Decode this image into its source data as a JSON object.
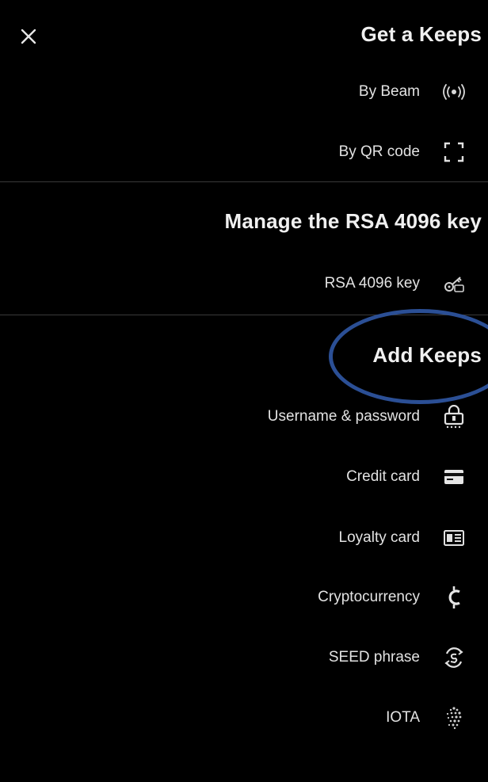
{
  "header": {
    "close_icon": "close-icon"
  },
  "sections": {
    "get": {
      "title": "Get a Keeps",
      "items": [
        {
          "label": "By Beam",
          "icon": "beam-icon"
        },
        {
          "label": "By QR code",
          "icon": "qr-scan-icon"
        }
      ]
    },
    "rsa": {
      "title": "Manage the RSA 4096 key",
      "items": [
        {
          "label": "RSA 4096 key",
          "icon": "key-icon"
        }
      ]
    },
    "add": {
      "title": "Add Keeps",
      "items": [
        {
          "label": "Username & password",
          "icon": "password-lock-icon"
        },
        {
          "label": "Credit card",
          "icon": "credit-card-icon"
        },
        {
          "label": "Loyalty card",
          "icon": "loyalty-card-icon"
        },
        {
          "label": "Cryptocurrency",
          "icon": "crypto-icon"
        },
        {
          "label": "SEED phrase",
          "icon": "seed-icon"
        },
        {
          "label": "IOTA",
          "icon": "iota-icon"
        }
      ]
    }
  },
  "colors": {
    "background": "#000000",
    "text": "#e6e6e6",
    "divider": "#3a3a3a",
    "highlight": "#2b4f95"
  }
}
